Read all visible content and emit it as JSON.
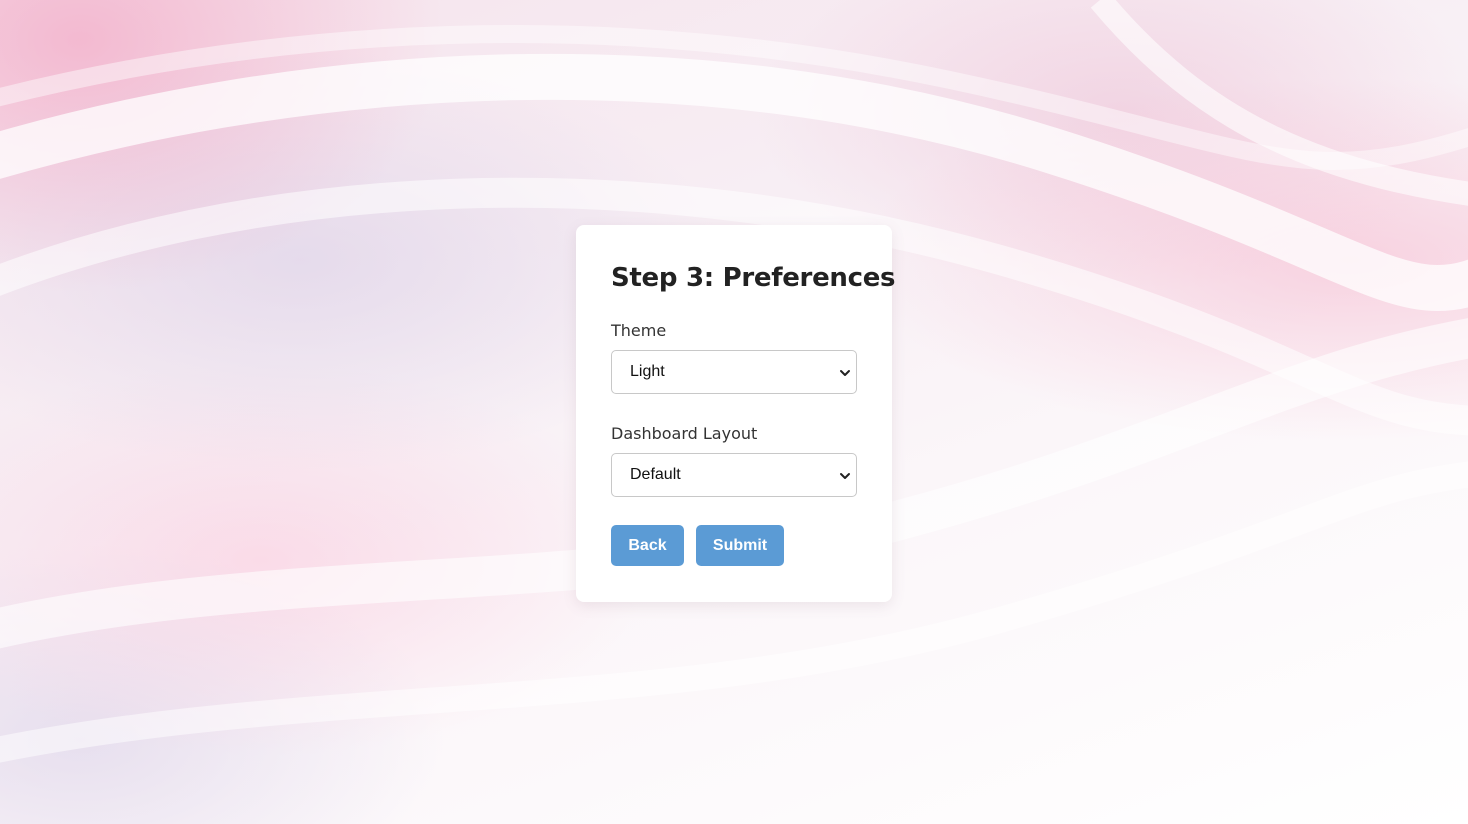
{
  "form": {
    "title": "Step 3: Preferences",
    "theme": {
      "label": "Theme",
      "selected": "Light"
    },
    "dashboard_layout": {
      "label": "Dashboard Layout",
      "selected": "Default"
    },
    "buttons": {
      "back_label": "Back",
      "submit_label": "Submit"
    }
  },
  "colors": {
    "button_bg": "#5b9bd5",
    "button_text": "#ffffff",
    "card_bg": "#ffffff"
  },
  "icons": {
    "dropdown": "chevron-down-icon"
  }
}
